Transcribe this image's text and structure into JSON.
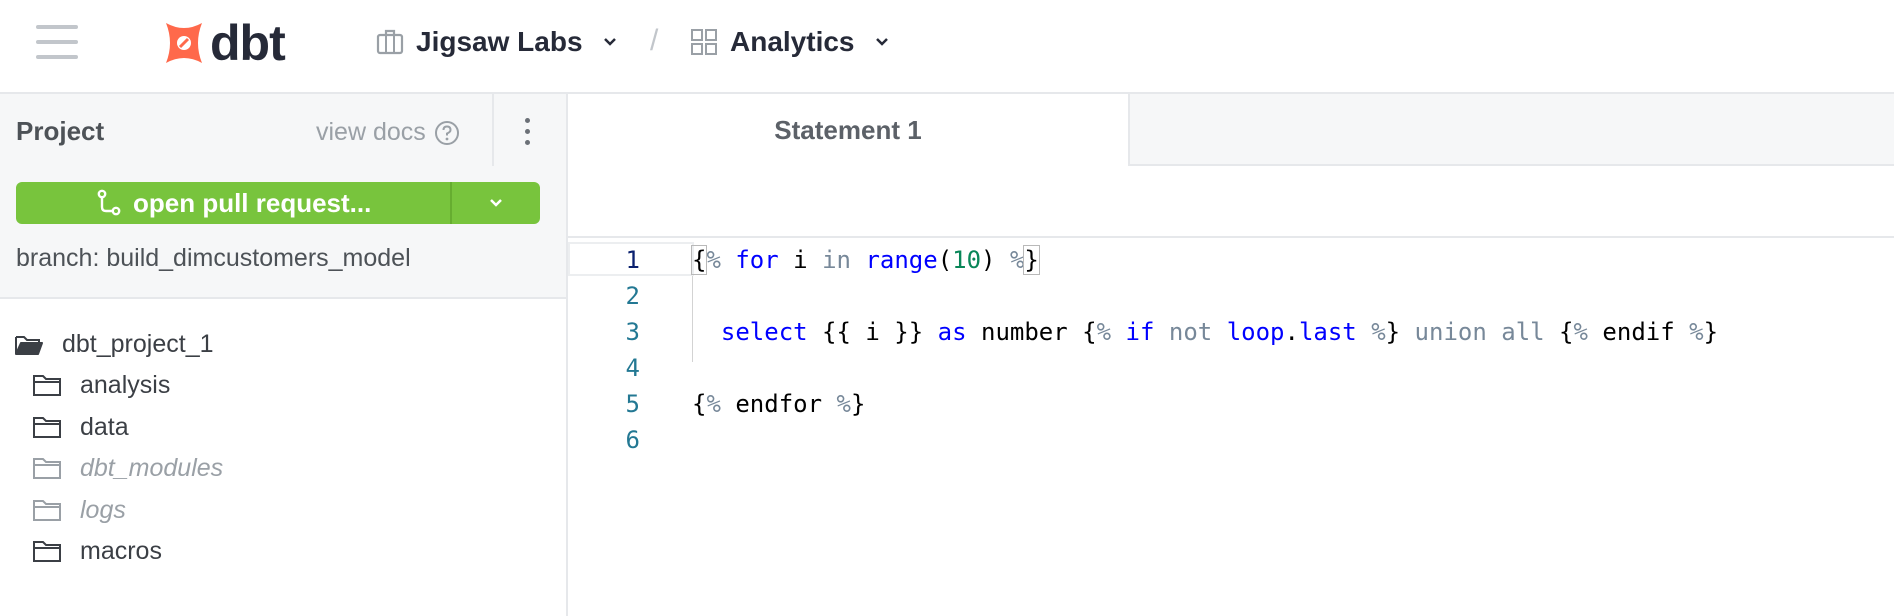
{
  "header": {
    "logo_text": "dbt",
    "org_name": "Jigsaw Labs",
    "separator": "/",
    "project_name": "Analytics"
  },
  "sidebar": {
    "title": "Project",
    "view_docs": "view docs",
    "pr_button_label": "open pull request...",
    "branch_label": "branch: build_dimcustomers_model",
    "tree": [
      {
        "label": "dbt_project_1",
        "kind": "folder-open",
        "muted": false
      },
      {
        "label": "analysis",
        "kind": "folder",
        "muted": false
      },
      {
        "label": "data",
        "kind": "folder",
        "muted": false
      },
      {
        "label": "dbt_modules",
        "kind": "folder",
        "muted": true
      },
      {
        "label": "logs",
        "kind": "folder",
        "muted": true
      },
      {
        "label": "macros",
        "kind": "folder",
        "muted": false
      }
    ]
  },
  "editor": {
    "tab_label": "Statement 1",
    "line_numbers": [
      "1",
      "2",
      "3",
      "4",
      "5",
      "6"
    ],
    "colors": {
      "keyword": "#0000ff",
      "number": "#098658",
      "operator": "#778899",
      "line_number": "#237893"
    }
  },
  "colors": {
    "brand_orange": "#ff694b",
    "pr_green": "#78c43d"
  }
}
